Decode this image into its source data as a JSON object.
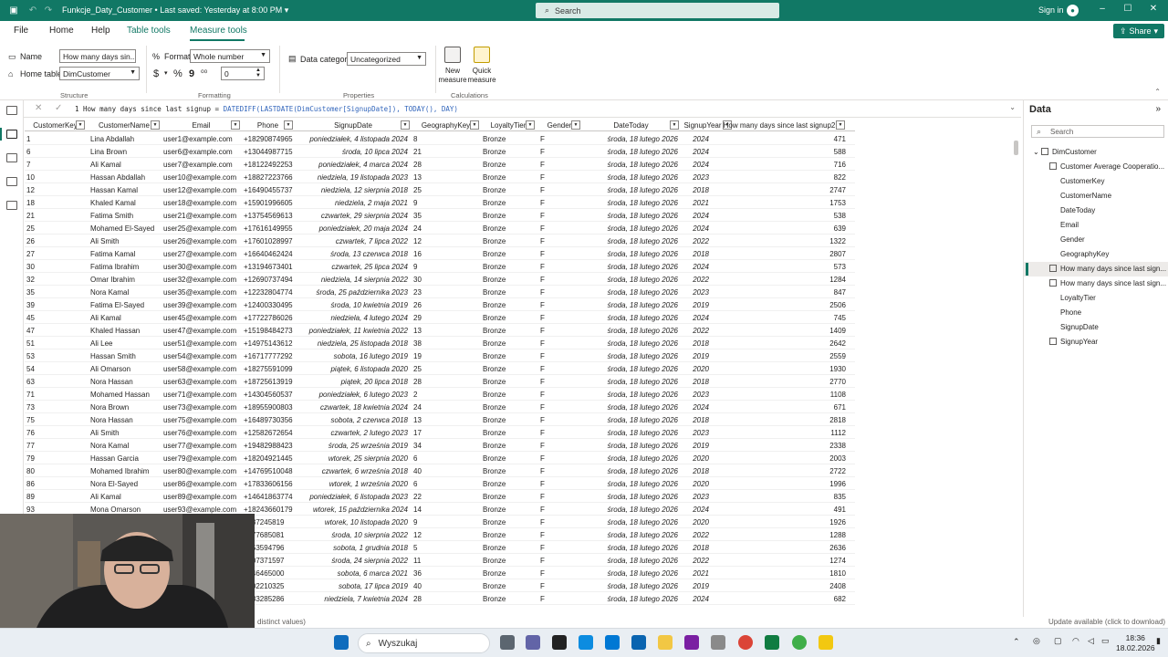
{
  "titlebar": {
    "title": "Funkcje_Daty_Customer  •  Last saved: Yesterday at 8:00 PM ▾",
    "search_placeholder": "Search",
    "signin": "Sign in"
  },
  "menu": {
    "file": "File",
    "home": "Home",
    "help": "Help",
    "table_tools": "Table tools",
    "measure_tools": "Measure tools",
    "share": "Share"
  },
  "ribbon": {
    "name_label": "Name",
    "name_value": "How many days sin...",
    "home_table_label": "Home table",
    "home_table_value": "DimCustomer",
    "format_label": "Format",
    "format_value": "Whole number",
    "currency": "$",
    "percent": "%",
    "comma": "9",
    "decimals": "0",
    "category_label": "Data category",
    "category_value": "Uncategorized",
    "new_measure": "New measure",
    "quick_measure": "Quick measure",
    "groups": {
      "structure": "Structure",
      "formatting": "Formatting",
      "properties": "Properties",
      "calculations": "Calculations"
    }
  },
  "formula": {
    "line": "1",
    "text_a": "How many days since last signup = ",
    "text_b": "DATEDIFF(LASTDATE(DimCustomer[SignupDate]), TODAY(), DAY)"
  },
  "table": {
    "headers": [
      "CustomerKey",
      "CustomerName",
      "Email",
      "Phone",
      "SignupDate",
      "GeographyKey",
      "LoyaltyTier",
      "Gender",
      "DateToday",
      "SignupYear",
      "How many days since last signup2"
    ],
    "rows": [
      [
        "1",
        "Lina Abdallah",
        "user1@example.com",
        "+18290874965",
        "poniedziałek, 4 listopada 2024",
        "8",
        "Bronze",
        "F",
        "środa, 18 lutego 2026",
        "2024",
        "471"
      ],
      [
        "6",
        "Lina Brown",
        "user6@example.com",
        "+13044987715",
        "środa, 10 lipca 2024",
        "21",
        "Bronze",
        "F",
        "środa, 18 lutego 2026",
        "2024",
        "588"
      ],
      [
        "7",
        "Ali Kamal",
        "user7@example.com",
        "+18122492253",
        "poniedziałek, 4 marca 2024",
        "28",
        "Bronze",
        "F",
        "środa, 18 lutego 2026",
        "2024",
        "716"
      ],
      [
        "10",
        "Hassan Abdallah",
        "user10@example.com",
        "+18827223766",
        "niedziela, 19 listopada 2023",
        "13",
        "Bronze",
        "F",
        "środa, 18 lutego 2026",
        "2023",
        "822"
      ],
      [
        "12",
        "Hassan Kamal",
        "user12@example.com",
        "+16490455737",
        "niedziela, 12 sierpnia 2018",
        "25",
        "Bronze",
        "F",
        "środa, 18 lutego 2026",
        "2018",
        "2747"
      ],
      [
        "18",
        "Khaled Kamal",
        "user18@example.com",
        "+15901996605",
        "niedziela, 2 maja 2021",
        "9",
        "Bronze",
        "F",
        "środa, 18 lutego 2026",
        "2021",
        "1753"
      ],
      [
        "21",
        "Fatima Smith",
        "user21@example.com",
        "+13754569613",
        "czwartek, 29 sierpnia 2024",
        "35",
        "Bronze",
        "F",
        "środa, 18 lutego 2026",
        "2024",
        "538"
      ],
      [
        "25",
        "Mohamed El-Sayed",
        "user25@example.com",
        "+17616149955",
        "poniedziałek, 20 maja 2024",
        "24",
        "Bronze",
        "F",
        "środa, 18 lutego 2026",
        "2024",
        "639"
      ],
      [
        "26",
        "Ali Smith",
        "user26@example.com",
        "+17601028997",
        "czwartek, 7 lipca 2022",
        "12",
        "Bronze",
        "F",
        "środa, 18 lutego 2026",
        "2022",
        "1322"
      ],
      [
        "27",
        "Fatima Kamal",
        "user27@example.com",
        "+16640462424",
        "środa, 13 czerwca 2018",
        "16",
        "Bronze",
        "F",
        "środa, 18 lutego 2026",
        "2018",
        "2807"
      ],
      [
        "30",
        "Fatima Ibrahim",
        "user30@example.com",
        "+13194673401",
        "czwartek, 25 lipca 2024",
        "9",
        "Bronze",
        "F",
        "środa, 18 lutego 2026",
        "2024",
        "573"
      ],
      [
        "32",
        "Omar Ibrahim",
        "user32@example.com",
        "+12690737494",
        "niedziela, 14 sierpnia 2022",
        "30",
        "Bronze",
        "F",
        "środa, 18 lutego 2026",
        "2022",
        "1284"
      ],
      [
        "35",
        "Nora Kamal",
        "user35@example.com",
        "+12232804774",
        "środa, 25 października 2023",
        "23",
        "Bronze",
        "F",
        "środa, 18 lutego 2026",
        "2023",
        "847"
      ],
      [
        "39",
        "Fatima El-Sayed",
        "user39@example.com",
        "+12400330495",
        "środa, 10 kwietnia 2019",
        "26",
        "Bronze",
        "F",
        "środa, 18 lutego 2026",
        "2019",
        "2506"
      ],
      [
        "45",
        "Ali Kamal",
        "user45@example.com",
        "+17722786026",
        "niedziela, 4 lutego 2024",
        "29",
        "Bronze",
        "F",
        "środa, 18 lutego 2026",
        "2024",
        "745"
      ],
      [
        "47",
        "Khaled Hassan",
        "user47@example.com",
        "+15198484273",
        "poniedziałek, 11 kwietnia 2022",
        "13",
        "Bronze",
        "F",
        "środa, 18 lutego 2026",
        "2022",
        "1409"
      ],
      [
        "51",
        "Ali Lee",
        "user51@example.com",
        "+14975143612",
        "niedziela, 25 listopada 2018",
        "38",
        "Bronze",
        "F",
        "środa, 18 lutego 2026",
        "2018",
        "2642"
      ],
      [
        "53",
        "Hassan Smith",
        "user54@example.com",
        "+16717777292",
        "sobota, 16 lutego 2019",
        "19",
        "Bronze",
        "F",
        "środa, 18 lutego 2026",
        "2019",
        "2559"
      ],
      [
        "54",
        "Ali Omarson",
        "user58@example.com",
        "+18275591099",
        "piątek, 6 listopada 2020",
        "25",
        "Bronze",
        "F",
        "środa, 18 lutego 2026",
        "2020",
        "1930"
      ],
      [
        "63",
        "Nora Hassan",
        "user63@example.com",
        "+18725613919",
        "piątek, 20 lipca 2018",
        "28",
        "Bronze",
        "F",
        "środa, 18 lutego 2026",
        "2018",
        "2770"
      ],
      [
        "71",
        "Mohamed Hassan",
        "user71@example.com",
        "+14304560537",
        "poniedziałek, 6 lutego 2023",
        "2",
        "Bronze",
        "F",
        "środa, 18 lutego 2026",
        "2023",
        "1108"
      ],
      [
        "73",
        "Nora Brown",
        "user73@example.com",
        "+18955900803",
        "czwartek, 18 kwietnia 2024",
        "24",
        "Bronze",
        "F",
        "środa, 18 lutego 2026",
        "2024",
        "671"
      ],
      [
        "75",
        "Nora Hassan",
        "user75@example.com",
        "+16489730356",
        "sobota, 2 czerwca 2018",
        "13",
        "Bronze",
        "F",
        "środa, 18 lutego 2026",
        "2018",
        "2818"
      ],
      [
        "76",
        "Ali Smith",
        "user76@example.com",
        "+12582672654",
        "czwartek, 2 lutego 2023",
        "17",
        "Bronze",
        "F",
        "środa, 18 lutego 2026",
        "2023",
        "1112"
      ],
      [
        "77",
        "Nora Kamal",
        "user77@example.com",
        "+19482988423",
        "środa, 25 września 2019",
        "34",
        "Bronze",
        "F",
        "środa, 18 lutego 2026",
        "2019",
        "2338"
      ],
      [
        "79",
        "Hassan Garcia",
        "user79@example.com",
        "+18204921445",
        "wtorek, 25 sierpnia 2020",
        "6",
        "Bronze",
        "F",
        "środa, 18 lutego 2026",
        "2020",
        "2003"
      ],
      [
        "80",
        "Mohamed Ibrahim",
        "user80@example.com",
        "+14769510048",
        "czwartek, 6 września 2018",
        "40",
        "Bronze",
        "F",
        "środa, 18 lutego 2026",
        "2018",
        "2722"
      ],
      [
        "86",
        "Nora El-Sayed",
        "user86@example.com",
        "+17833606156",
        "wtorek, 1 września 2020",
        "6",
        "Bronze",
        "F",
        "środa, 18 lutego 2026",
        "2020",
        "1996"
      ],
      [
        "89",
        "Ali Kamal",
        "user89@example.com",
        "+14641863774",
        "poniedziałek, 6 listopada 2023",
        "22",
        "Bronze",
        "F",
        "środa, 18 lutego 2026",
        "2023",
        "835"
      ],
      [
        "93",
        "Mona Omarson",
        "user93@example.com",
        "+18243660179",
        "wtorek, 15 października 2024",
        "14",
        "Bronze",
        "F",
        "środa, 18 lutego 2026",
        "2024",
        "491"
      ],
      [
        "",
        "",
        "",
        "7637245819",
        "wtorek, 10 listopada 2020",
        "9",
        "Bronze",
        "F",
        "środa, 18 lutego 2026",
        "2020",
        "1926"
      ],
      [
        "",
        "",
        "",
        "4877685081",
        "środa, 10 sierpnia 2022",
        "12",
        "Bronze",
        "F",
        "środa, 18 lutego 2026",
        "2022",
        "1288"
      ],
      [
        "",
        "",
        "",
        "4653594796",
        "sobota, 1 grudnia 2018",
        "5",
        "Bronze",
        "F",
        "środa, 18 lutego 2026",
        "2018",
        "2636"
      ],
      [
        "",
        "",
        "",
        "4607371597",
        "środa, 24 sierpnia 2022",
        "11",
        "Bronze",
        "F",
        "środa, 18 lutego 2026",
        "2022",
        "1274"
      ],
      [
        "",
        "",
        "",
        "3846465000",
        "sobota, 6 marca 2021",
        "36",
        "Bronze",
        "F",
        "środa, 18 lutego 2026",
        "2021",
        "1810"
      ],
      [
        "",
        "",
        "",
        "7202210325",
        "sobota, 17 lipca 2019",
        "40",
        "Bronze",
        "F",
        "środa, 18 lutego 2026",
        "2019",
        "2408"
      ],
      [
        "",
        "",
        "",
        "7283285286",
        "niedziela, 7 kwietnia 2024",
        "28",
        "Bronze",
        "F",
        "środa, 18 lutego 2026",
        "2024",
        "682"
      ]
    ]
  },
  "status": {
    "left": "distinct values)",
    "right": "Update available (click to download)"
  },
  "data_pane": {
    "title": "Data",
    "search_placeholder": "Search",
    "table": "DimCustomer",
    "fields": [
      "Customer Average Cooperatio...",
      "CustomerKey",
      "CustomerName",
      "DateToday",
      "Email",
      "Gender",
      "GeographyKey",
      "How many days since last sign...",
      "How many days since last sign...",
      "LoyaltyTier",
      "Phone",
      "SignupDate",
      "SignupYear"
    ]
  },
  "taskbar": {
    "search": "Wyszukaj",
    "time": "18:36",
    "date": "18.02.2026"
  },
  "colors": {
    "accent": "#117865",
    "taskbar": "#e9eef3"
  }
}
